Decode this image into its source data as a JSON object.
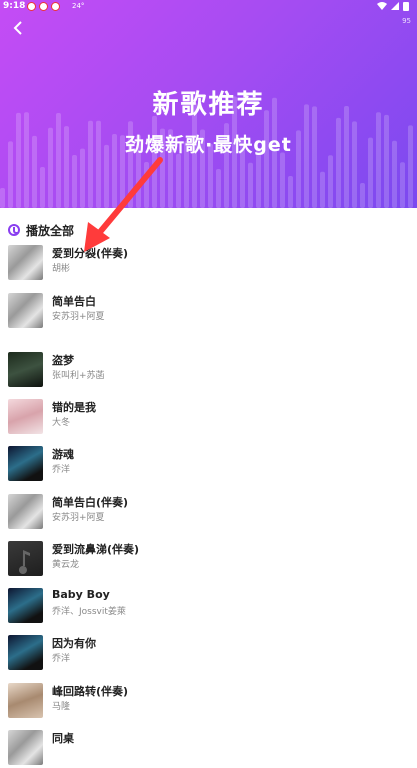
{
  "status_bar": {
    "time": "9:18",
    "temp": "24°"
  },
  "header": {
    "back_icon": "back-arrow-icon",
    "corner_text": "95",
    "title": "新歌推荐",
    "subtitle": "劲爆新歌·最快get"
  },
  "playall": {
    "label": "播放全部",
    "icon": "play-all-icon"
  },
  "songs": [
    {
      "name": "爱到分裂(伴奏)",
      "artist": "胡彬",
      "cover": "gray-collage"
    },
    {
      "name": "简单告白",
      "artist": "安苏羽+阿夏",
      "cover": "gray-collage"
    },
    {
      "name": "盗梦",
      "artist": "张叫利+苏菡",
      "cover": "dark-portrait"
    },
    {
      "name": "错的是我",
      "artist": "大冬",
      "cover": "pink-portrait"
    },
    {
      "name": "游魂",
      "artist": "乔洋",
      "cover": "dark-art"
    },
    {
      "name": "简单告白(伴奏)",
      "artist": "安苏羽+阿夏",
      "cover": "gray-collage"
    },
    {
      "name": "爱到流鼻涕(伴奏)",
      "artist": "黄云龙",
      "cover": "music-note"
    },
    {
      "name": "Baby Boy",
      "artist": "乔洋、Jossvit姜萊",
      "cover": "dark-art"
    },
    {
      "name": "因为有你",
      "artist": "乔洋",
      "cover": "dark-art"
    },
    {
      "name": "峰回路转(伴奏)",
      "artist": "马隆",
      "cover": "light-portrait"
    },
    {
      "name": "同桌",
      "artist": "",
      "cover": "gray-collage"
    }
  ],
  "colors": {
    "banner_start": "#c54cf5",
    "banner_end": "#7b49f0",
    "accent": "#8a3ff0",
    "annotation_arrow": "#ff3b3b"
  }
}
